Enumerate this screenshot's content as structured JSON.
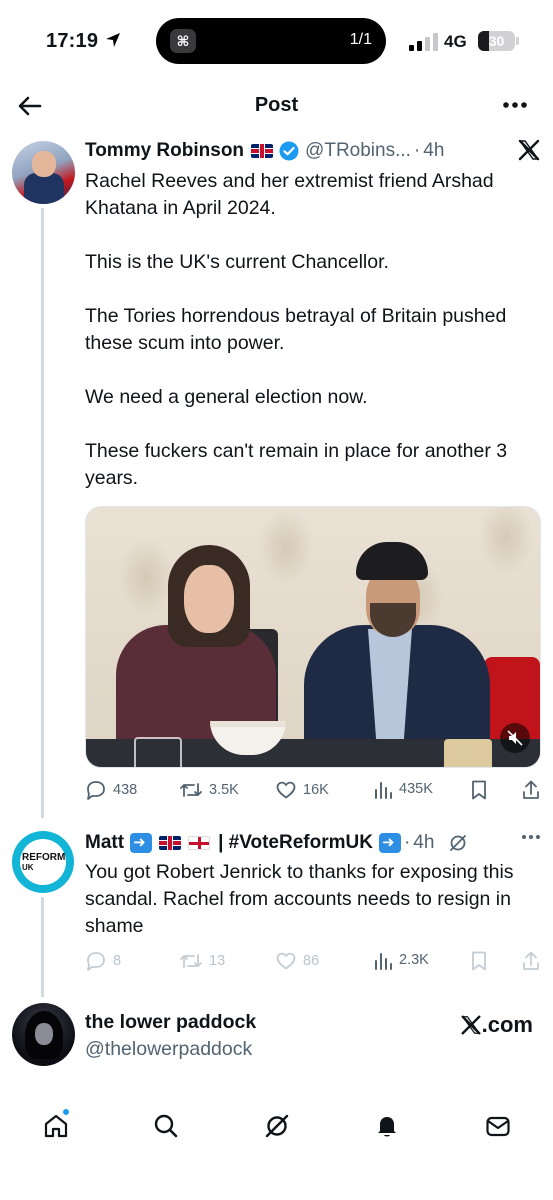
{
  "status_bar": {
    "time": "17:19",
    "island_count": "1/1",
    "network": "4G",
    "battery": "30",
    "battery_level_percent": 30
  },
  "header": {
    "title": "Post"
  },
  "post": {
    "author_name": "Tommy Robinson",
    "author_handle": "@TRobins...",
    "time_ago": "4h",
    "paragraphs": [
      "Rachel Reeves and her extremist friend Arshad Khatana in April 2024.",
      "This is the UK's current Chancellor.",
      "The Tories horrendous betrayal of Britain pushed these scum into power.",
      "We need a general election now.",
      "These fuckers can't remain in place for another 3 years."
    ],
    "stats": {
      "replies": "438",
      "reposts": "3.5K",
      "likes": "16K",
      "views": "435K"
    }
  },
  "reply": {
    "author_name": "Matt",
    "author_suffix": "| #VoteReformUK",
    "time_ago": "4h",
    "avatar_text": "REFORM",
    "avatar_subtext": "UK",
    "text": "You got Robert Jenrick to thanks for exposing this scandal. Rachel from accounts needs to resign in shame",
    "stats": {
      "replies": "8",
      "reposts": "13",
      "likes": "86",
      "views": "2.3K"
    }
  },
  "link_card": {
    "name": "the lower paddock",
    "handle": "@thelowerpaddock",
    "domain": ".com"
  },
  "colors": {
    "text": "#0f1419",
    "secondary": "#536471",
    "verified": "#1d9bf0",
    "thread_line": "#cfd9de",
    "reform_accent": "#12b5d6"
  },
  "icons": [
    "back-arrow-icon",
    "more-icon",
    "verified-icon",
    "x-logo-icon",
    "reply-icon",
    "repost-icon",
    "like-icon",
    "views-icon",
    "bookmark-icon",
    "share-icon",
    "grok-icon",
    "home-icon",
    "search-icon",
    "notifications-icon",
    "messages-icon",
    "mute-icon"
  ]
}
